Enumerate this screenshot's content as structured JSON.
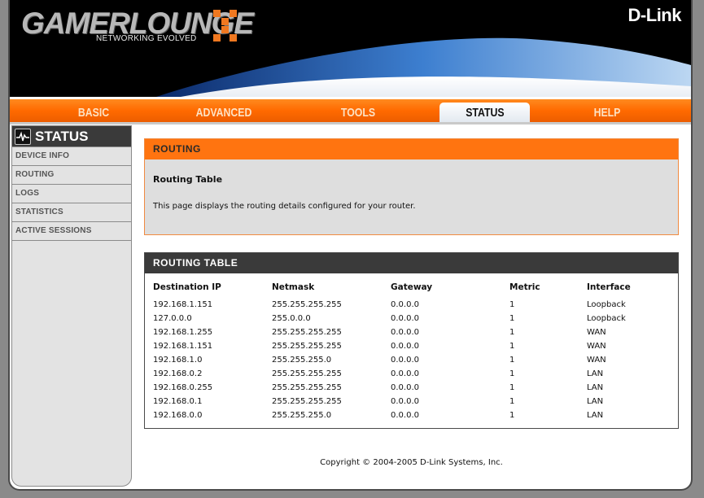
{
  "header": {
    "brand": "GAMERLOUNGE",
    "tagline": "NETWORKING EVOLVED",
    "vendor": "D-Link"
  },
  "nav": {
    "tabs": [
      {
        "label": "BASIC"
      },
      {
        "label": "ADVANCED"
      },
      {
        "label": "TOOLS"
      },
      {
        "label": "STATUS",
        "active": true
      },
      {
        "label": "HELP"
      }
    ]
  },
  "sidebar": {
    "title": "STATUS",
    "items": [
      {
        "label": "DEVICE INFO"
      },
      {
        "label": "ROUTING"
      },
      {
        "label": "LOGS"
      },
      {
        "label": "STATISTICS"
      },
      {
        "label": "ACTIVE SESSIONS"
      }
    ]
  },
  "info": {
    "heading": "ROUTING",
    "title": "Routing Table",
    "description": "This page displays the routing details configured for your router."
  },
  "routing_table": {
    "heading": "ROUTING TABLE",
    "columns": [
      "Destination IP",
      "Netmask",
      "Gateway",
      "Metric",
      "Interface"
    ],
    "rows": [
      [
        "192.168.1.151",
        "255.255.255.255",
        "0.0.0.0",
        "1",
        "Loopback"
      ],
      [
        "127.0.0.0",
        "255.0.0.0",
        "0.0.0.0",
        "1",
        "Loopback"
      ],
      [
        "192.168.1.255",
        "255.255.255.255",
        "0.0.0.0",
        "1",
        "WAN"
      ],
      [
        "192.168.1.151",
        "255.255.255.255",
        "0.0.0.0",
        "1",
        "WAN"
      ],
      [
        "192.168.1.0",
        "255.255.255.0",
        "0.0.0.0",
        "1",
        "WAN"
      ],
      [
        "192.168.0.2",
        "255.255.255.255",
        "0.0.0.0",
        "1",
        "LAN"
      ],
      [
        "192.168.0.255",
        "255.255.255.255",
        "0.0.0.0",
        "1",
        "LAN"
      ],
      [
        "192.168.0.1",
        "255.255.255.255",
        "0.0.0.0",
        "1",
        "LAN"
      ],
      [
        "192.168.0.0",
        "255.255.255.0",
        "0.0.0.0",
        "1",
        "LAN"
      ]
    ]
  },
  "footer": {
    "copyright": "Copyright © 2004-2005 D-Link Systems, Inc."
  },
  "colors": {
    "accent": "#ff7410",
    "dark_bar": "#3a3a3a",
    "panel_bg": "#dedede"
  }
}
